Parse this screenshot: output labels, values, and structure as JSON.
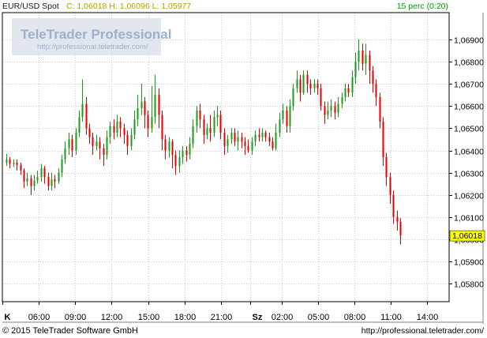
{
  "header": {
    "symbol": "EUR/USD Spot",
    "ohlc": "C: 1,06018 H: 1,06096 L: 1,05977",
    "interval": "15 perc (0:20)"
  },
  "watermark": {
    "brand": "TeleTrader Professional",
    "url": "http://professional.teletrader.com/"
  },
  "footer": {
    "copyright": "© 2015 TeleTrader Software GmbH",
    "url": "http://professional.teletrader.com/"
  },
  "colors": {
    "up": "#1a9c1a",
    "down": "#e00000",
    "header_text": "#b8a000",
    "header_interval": "#009900",
    "last_price_bg": "#ffff00",
    "grid": "#c8c8c8",
    "watermark": "#8fa3c4"
  },
  "chart_data": {
    "type": "candlestick",
    "title": "EUR/USD Spot",
    "interval": "15 perc",
    "x_tick_labels": [
      {
        "label": "K",
        "hour": 3.0
      },
      {
        "label": "06:00",
        "hour": 6.0
      },
      {
        "label": "09:00",
        "hour": 9.0
      },
      {
        "label": "12:00",
        "hour": 12.0
      },
      {
        "label": "15:00",
        "hour": 15.0
      },
      {
        "label": "18:00",
        "hour": 18.0
      },
      {
        "label": "21:00",
        "hour": 21.0
      },
      {
        "label": "Sz",
        "hour": 23.4
      },
      {
        "label": "02:00",
        "hour": 26.0
      },
      {
        "label": "05:00",
        "hour": 29.0
      },
      {
        "label": "08:00",
        "hour": 32.0
      },
      {
        "label": "11:00",
        "hour": 35.0
      },
      {
        "label": "14:00",
        "hour": 38.0
      }
    ],
    "x_range_hours": [
      3.0,
      39.8
    ],
    "y_ticks": [
      "1,05800",
      "1,05900",
      "1,06000",
      "1,06100",
      "1,06200",
      "1,06300",
      "1,06400",
      "1,06500",
      "1,06600",
      "1,06700",
      "1,06800",
      "1,06900"
    ],
    "y_tick_values": [
      1.058,
      1.059,
      1.06,
      1.061,
      1.062,
      1.063,
      1.064,
      1.065,
      1.066,
      1.067,
      1.068,
      1.069
    ],
    "y_range": [
      1.0572,
      1.0702
    ],
    "last_price_label": "1,06018",
    "last_price": 1.06018,
    "grid": true,
    "candles": [
      {
        "open": 1.06345,
        "close": 1.0636,
        "high": 1.06385,
        "low": 1.0633
      },
      {
        "open": 1.0636,
        "close": 1.0634,
        "high": 1.0637,
        "low": 1.0632
      },
      {
        "open": 1.0634,
        "close": 1.06345,
        "high": 1.0636,
        "low": 1.06325
      },
      {
        "open": 1.06345,
        "close": 1.06335,
        "high": 1.0636,
        "low": 1.0631
      },
      {
        "open": 1.06335,
        "close": 1.0631,
        "high": 1.06345,
        "low": 1.0629
      },
      {
        "open": 1.0631,
        "close": 1.0626,
        "high": 1.0632,
        "low": 1.0623
      },
      {
        "open": 1.0626,
        "close": 1.06275,
        "high": 1.063,
        "low": 1.0624
      },
      {
        "open": 1.06275,
        "close": 1.0624,
        "high": 1.0629,
        "low": 1.062
      },
      {
        "open": 1.0624,
        "close": 1.06265,
        "high": 1.0629,
        "low": 1.0622
      },
      {
        "open": 1.06265,
        "close": 1.0628,
        "high": 1.0631,
        "low": 1.0625
      },
      {
        "open": 1.0628,
        "close": 1.0632,
        "high": 1.0634,
        "low": 1.0626
      },
      {
        "open": 1.0632,
        "close": 1.0628,
        "high": 1.0633,
        "low": 1.0625
      },
      {
        "open": 1.0628,
        "close": 1.0624,
        "high": 1.063,
        "low": 1.0622
      },
      {
        "open": 1.0624,
        "close": 1.0627,
        "high": 1.063,
        "low": 1.0622
      },
      {
        "open": 1.0627,
        "close": 1.0626,
        "high": 1.0629,
        "low": 1.0623
      },
      {
        "open": 1.0626,
        "close": 1.063,
        "high": 1.0632,
        "low": 1.0625
      },
      {
        "open": 1.063,
        "close": 1.0636,
        "high": 1.0638,
        "low": 1.0628
      },
      {
        "open": 1.0636,
        "close": 1.0641,
        "high": 1.0644,
        "low": 1.0634
      },
      {
        "open": 1.0641,
        "close": 1.0645,
        "high": 1.0648,
        "low": 1.0638
      },
      {
        "open": 1.0645,
        "close": 1.064,
        "high": 1.0647,
        "low": 1.0637
      },
      {
        "open": 1.064,
        "close": 1.0648,
        "high": 1.065,
        "low": 1.0638
      },
      {
        "open": 1.0648,
        "close": 1.0655,
        "high": 1.0658,
        "low": 1.0646
      },
      {
        "open": 1.0655,
        "close": 1.0661,
        "high": 1.0672,
        "low": 1.0653
      },
      {
        "open": 1.0661,
        "close": 1.065,
        "high": 1.0664,
        "low": 1.0647
      },
      {
        "open": 1.065,
        "close": 1.0646,
        "high": 1.0652,
        "low": 1.0643
      },
      {
        "open": 1.0646,
        "close": 1.0642,
        "high": 1.0648,
        "low": 1.0638
      },
      {
        "open": 1.0642,
        "close": 1.0644,
        "high": 1.0647,
        "low": 1.064
      },
      {
        "open": 1.0644,
        "close": 1.0641,
        "high": 1.0646,
        "low": 1.0636
      },
      {
        "open": 1.0641,
        "close": 1.0638,
        "high": 1.0643,
        "low": 1.0633
      },
      {
        "open": 1.0638,
        "close": 1.0646,
        "high": 1.0649,
        "low": 1.0636
      },
      {
        "open": 1.0646,
        "close": 1.0651,
        "high": 1.0653,
        "low": 1.0643
      },
      {
        "open": 1.0651,
        "close": 1.0648,
        "high": 1.0654,
        "low": 1.0645
      },
      {
        "open": 1.0648,
        "close": 1.0653,
        "high": 1.0656,
        "low": 1.0646
      },
      {
        "open": 1.0653,
        "close": 1.065,
        "high": 1.0655,
        "low": 1.0646
      },
      {
        "open": 1.065,
        "close": 1.0647,
        "high": 1.0652,
        "low": 1.0643
      },
      {
        "open": 1.0647,
        "close": 1.0642,
        "high": 1.0649,
        "low": 1.0638
      },
      {
        "open": 1.0642,
        "close": 1.0647,
        "high": 1.065,
        "low": 1.064
      },
      {
        "open": 1.0647,
        "close": 1.0654,
        "high": 1.0658,
        "low": 1.0645
      },
      {
        "open": 1.0654,
        "close": 1.0659,
        "high": 1.0665,
        "low": 1.0651
      },
      {
        "open": 1.0659,
        "close": 1.0662,
        "high": 1.067,
        "low": 1.0656
      },
      {
        "open": 1.0662,
        "close": 1.0656,
        "high": 1.0664,
        "low": 1.065
      },
      {
        "open": 1.0656,
        "close": 1.065,
        "high": 1.0658,
        "low": 1.0646
      },
      {
        "open": 1.065,
        "close": 1.0655,
        "high": 1.0669,
        "low": 1.0648
      },
      {
        "open": 1.0655,
        "close": 1.0665,
        "high": 1.0674,
        "low": 1.0652
      },
      {
        "open": 1.0665,
        "close": 1.0656,
        "high": 1.0668,
        "low": 1.065
      },
      {
        "open": 1.0656,
        "close": 1.0645,
        "high": 1.0658,
        "low": 1.064
      },
      {
        "open": 1.0645,
        "close": 1.064,
        "high": 1.0647,
        "low": 1.0636
      },
      {
        "open": 1.064,
        "close": 1.0644,
        "high": 1.0646,
        "low": 1.0637
      },
      {
        "open": 1.0644,
        "close": 1.0638,
        "high": 1.0645,
        "low": 1.0632
      },
      {
        "open": 1.0638,
        "close": 1.0633,
        "high": 1.064,
        "low": 1.0629
      },
      {
        "open": 1.0633,
        "close": 1.0637,
        "high": 1.064,
        "low": 1.063
      },
      {
        "open": 1.0637,
        "close": 1.064,
        "high": 1.0642,
        "low": 1.0634
      },
      {
        "open": 1.064,
        "close": 1.0638,
        "high": 1.0642,
        "low": 1.0635
      },
      {
        "open": 1.0638,
        "close": 1.0643,
        "high": 1.0646,
        "low": 1.0636
      },
      {
        "open": 1.0643,
        "close": 1.0651,
        "high": 1.0654,
        "low": 1.0641
      },
      {
        "open": 1.0651,
        "close": 1.0658,
        "high": 1.066,
        "low": 1.0648
      },
      {
        "open": 1.0658,
        "close": 1.0654,
        "high": 1.0661,
        "low": 1.065
      },
      {
        "open": 1.0654,
        "close": 1.0647,
        "high": 1.0656,
        "low": 1.0643
      },
      {
        "open": 1.0647,
        "close": 1.065,
        "high": 1.0652,
        "low": 1.0645
      },
      {
        "open": 1.065,
        "close": 1.0648,
        "high": 1.0656,
        "low": 1.0644
      },
      {
        "open": 1.0648,
        "close": 1.0655,
        "high": 1.0658,
        "low": 1.0646
      },
      {
        "open": 1.0655,
        "close": 1.0656,
        "high": 1.066,
        "low": 1.0651
      },
      {
        "open": 1.0656,
        "close": 1.0648,
        "high": 1.0658,
        "low": 1.0645
      },
      {
        "open": 1.0648,
        "close": 1.0642,
        "high": 1.065,
        "low": 1.0638
      },
      {
        "open": 1.0642,
        "close": 1.0645,
        "high": 1.0647,
        "low": 1.0639
      },
      {
        "open": 1.0645,
        "close": 1.0648,
        "high": 1.065,
        "low": 1.0643
      },
      {
        "open": 1.0648,
        "close": 1.0644,
        "high": 1.065,
        "low": 1.0642
      },
      {
        "open": 1.0644,
        "close": 1.0646,
        "high": 1.0649,
        "low": 1.064
      },
      {
        "open": 1.0646,
        "close": 1.0644,
        "high": 1.0648,
        "low": 1.0641
      },
      {
        "open": 1.0644,
        "close": 1.0642,
        "high": 1.0646,
        "low": 1.0638
      },
      {
        "open": 1.0642,
        "close": 1.064,
        "high": 1.0645,
        "low": 1.0639
      },
      {
        "open": 1.064,
        "close": 1.0644,
        "high": 1.0646,
        "low": 1.0638
      },
      {
        "open": 1.0644,
        "close": 1.0647,
        "high": 1.0649,
        "low": 1.0642
      },
      {
        "open": 1.0647,
        "close": 1.0646,
        "high": 1.065,
        "low": 1.0644
      },
      {
        "open": 1.0646,
        "close": 1.0648,
        "high": 1.065,
        "low": 1.0644
      },
      {
        "open": 1.0648,
        "close": 1.0646,
        "high": 1.0649,
        "low": 1.0644
      },
      {
        "open": 1.0646,
        "close": 1.0644,
        "high": 1.0648,
        "low": 1.0642
      },
      {
        "open": 1.0644,
        "close": 1.0641,
        "high": 1.0646,
        "low": 1.064
      },
      {
        "open": 1.0641,
        "close": 1.0648,
        "high": 1.0652,
        "low": 1.064
      },
      {
        "open": 1.0648,
        "close": 1.0654,
        "high": 1.0657,
        "low": 1.0646
      },
      {
        "open": 1.0654,
        "close": 1.0658,
        "high": 1.0661,
        "low": 1.0652
      },
      {
        "open": 1.0658,
        "close": 1.0651,
        "high": 1.066,
        "low": 1.0648
      },
      {
        "open": 1.0651,
        "close": 1.066,
        "high": 1.0663,
        "low": 1.0648
      },
      {
        "open": 1.066,
        "close": 1.0668,
        "high": 1.067,
        "low": 1.0658
      },
      {
        "open": 1.0668,
        "close": 1.0672,
        "high": 1.0676,
        "low": 1.0666
      },
      {
        "open": 1.0672,
        "close": 1.0666,
        "high": 1.0674,
        "low": 1.0662
      },
      {
        "open": 1.0666,
        "close": 1.0674,
        "high": 1.0676,
        "low": 1.0665
      },
      {
        "open": 1.0674,
        "close": 1.067,
        "high": 1.0676,
        "low": 1.0666
      },
      {
        "open": 1.067,
        "close": 1.0668,
        "high": 1.0672,
        "low": 1.0665
      },
      {
        "open": 1.0668,
        "close": 1.067,
        "high": 1.0672,
        "low": 1.0666
      },
      {
        "open": 1.067,
        "close": 1.0668,
        "high": 1.0672,
        "low": 1.0665
      },
      {
        "open": 1.0668,
        "close": 1.066,
        "high": 1.067,
        "low": 1.0658
      },
      {
        "open": 1.066,
        "close": 1.0656,
        "high": 1.0662,
        "low": 1.0652
      },
      {
        "open": 1.0656,
        "close": 1.0658,
        "high": 1.0662,
        "low": 1.0654
      },
      {
        "open": 1.0658,
        "close": 1.066,
        "high": 1.0663,
        "low": 1.0655
      },
      {
        "open": 1.066,
        "close": 1.0657,
        "high": 1.0662,
        "low": 1.0654
      },
      {
        "open": 1.0657,
        "close": 1.0661,
        "high": 1.0664,
        "low": 1.0655
      },
      {
        "open": 1.0661,
        "close": 1.0664,
        "high": 1.0666,
        "low": 1.0659
      },
      {
        "open": 1.0664,
        "close": 1.0668,
        "high": 1.067,
        "low": 1.0662
      },
      {
        "open": 1.0668,
        "close": 1.0666,
        "high": 1.067,
        "low": 1.0664
      },
      {
        "open": 1.0666,
        "close": 1.0673,
        "high": 1.0676,
        "low": 1.0664
      },
      {
        "open": 1.0673,
        "close": 1.068,
        "high": 1.0684,
        "low": 1.067
      },
      {
        "open": 1.068,
        "close": 1.0685,
        "high": 1.069,
        "low": 1.0676
      },
      {
        "open": 1.0685,
        "close": 1.0679,
        "high": 1.0688,
        "low": 1.0676
      },
      {
        "open": 1.0679,
        "close": 1.0683,
        "high": 1.0688,
        "low": 1.0674
      },
      {
        "open": 1.0683,
        "close": 1.0676,
        "high": 1.0685,
        "low": 1.067
      },
      {
        "open": 1.0676,
        "close": 1.067,
        "high": 1.0678,
        "low": 1.0666
      },
      {
        "open": 1.067,
        "close": 1.0664,
        "high": 1.0672,
        "low": 1.066
      },
      {
        "open": 1.0664,
        "close": 1.0653,
        "high": 1.0666,
        "low": 1.065
      },
      {
        "open": 1.0653,
        "close": 1.0637,
        "high": 1.0655,
        "low": 1.0633
      },
      {
        "open": 1.0637,
        "close": 1.0628,
        "high": 1.0639,
        "low": 1.0624
      },
      {
        "open": 1.0628,
        "close": 1.062,
        "high": 1.063,
        "low": 1.0616
      },
      {
        "open": 1.062,
        "close": 1.061,
        "high": 1.0622,
        "low": 1.0607
      },
      {
        "open": 1.061,
        "close": 1.0608,
        "high": 1.0613,
        "low": 1.0604
      },
      {
        "open": 1.0608,
        "close": 1.06018,
        "high": 1.06096,
        "low": 1.05977
      }
    ]
  }
}
